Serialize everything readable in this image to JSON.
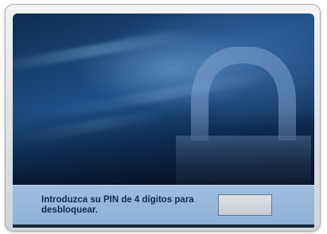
{
  "unlock_screen": {
    "lock_icon": "lock-icon",
    "prompt_text": "Introduzca su PIN de 4 dígitos para desbloquear.",
    "pin_input": {
      "value": "",
      "placeholder": ""
    }
  },
  "colors": {
    "background_blue": "#1d4f86",
    "info_bar": "#9fbddc",
    "prompt_text": "#0f2a4e",
    "input_fill": "#d2d5d9"
  }
}
